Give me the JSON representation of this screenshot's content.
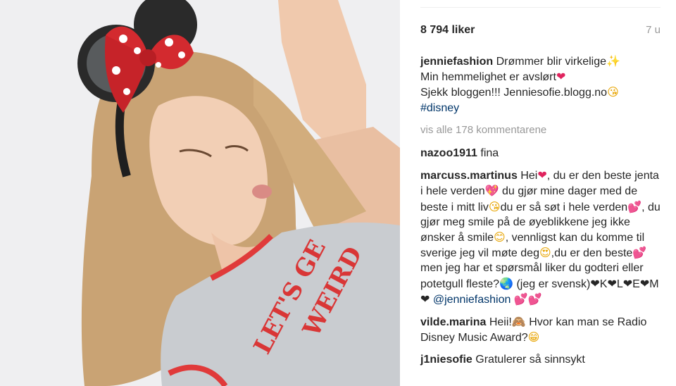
{
  "post": {
    "likes": "8 794 liker",
    "age": "7 u"
  },
  "caption": {
    "user": "jenniefashion",
    "line1": "Drømmer blir virkelige",
    "line2": "Min hemmelighet er avslørt",
    "line3": "Sjekk bloggen!!! Jenniesofie.blogg.no",
    "hashtag": "#disney"
  },
  "view_all": "vis alle 178 kommentarene",
  "comments": [
    {
      "user": "nazoo1911",
      "text": "fina"
    },
    {
      "user": "marcuss.martinus",
      "p1": "Hei",
      "p2": ", du er den beste jenta i hele verden",
      "p3": " du gjør mine dager med de beste i mitt liv",
      "p4": "du er så søt i hele verden",
      "p5": ", du gjør meg smile på de øyeblikkene jeg ikke ønsker å smile",
      "p6": ", vennligst kan du komme til sverige jeg vil møte deg",
      "p7": ",du er den beste",
      "p8": " men jeg har et spørsmål liker du godteri eller potetgull fleste?",
      "p9": " (jeg er svensk)",
      "p10": "K",
      "p11": "L",
      "p12": "E",
      "p13": "M",
      "mention": "@jenniefashion"
    },
    {
      "user": "vilde.marina",
      "p1": "Heii!",
      "p2": " Hvor kan man se Radio Disney Music Award?"
    },
    {
      "user": "j1niesofie",
      "text": "Gratulerer så sinnsykt"
    }
  ],
  "photo": {
    "shirt_text_1": "LET'S GE",
    "shirt_text_2": "WEIRD"
  },
  "icons": {
    "sparkles": "✨",
    "heart": "❤",
    "kiss": "😘",
    "sparkling_heart": "💖",
    "two_hearts": "💕",
    "smile": "😊",
    "heart_eyes": "😍",
    "globe": "🌏",
    "monkey": "🙈",
    "grin": "😁"
  },
  "colors": {
    "link": "#003569",
    "muted": "#999999",
    "text": "#262626"
  }
}
